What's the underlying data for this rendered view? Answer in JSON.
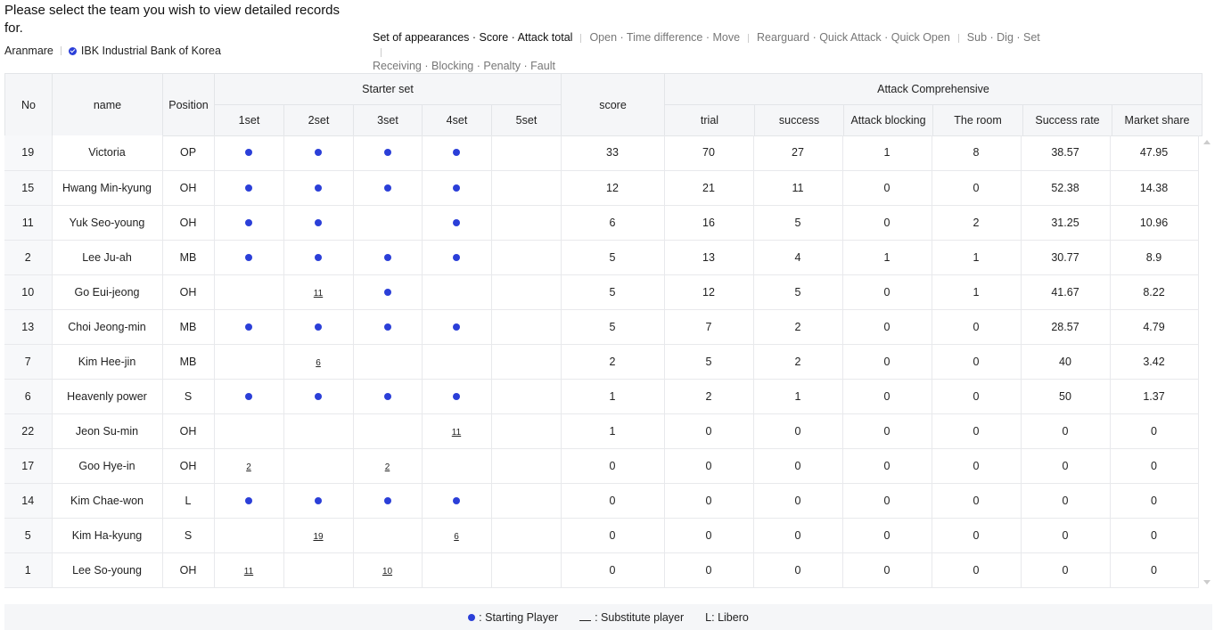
{
  "prompt": "Please select the team you wish to view detailed records for.",
  "teams": [
    {
      "label": "Aranmare",
      "selected": false
    },
    {
      "label": "IBK Industrial Bank of Korea",
      "selected": true
    }
  ],
  "categories": [
    {
      "line": 1,
      "label": "Set of appearances · Score · Attack total",
      "active": true
    },
    {
      "line": 1,
      "label": "Open · Time difference · Move",
      "active": false
    },
    {
      "line": 1,
      "label": "Rearguard · Quick Attack · Quick Open",
      "active": false
    },
    {
      "line": 1,
      "label": "Sub · Dig · Set",
      "active": false
    },
    {
      "line": 2,
      "label": "Receiving · Blocking · Penalty · Fault",
      "active": false
    }
  ],
  "headers": {
    "no": "No",
    "name": "name",
    "position": "Position",
    "starter_set": "Starter set",
    "sets": [
      "1set",
      "2set",
      "3set",
      "4set",
      "5set"
    ],
    "score": "score",
    "attack_group": "Attack Comprehensive",
    "attack_cols": [
      "trial",
      "success",
      "Attack blocking",
      "The room",
      "Success rate",
      "Market share"
    ]
  },
  "rows": [
    {
      "no": "19",
      "name": "Victoria",
      "pos": "OP",
      "sets": [
        "S",
        "S",
        "S",
        "S",
        ""
      ],
      "score": "33",
      "attack": [
        "70",
        "27",
        "1",
        "8",
        "38.57",
        "47.95"
      ]
    },
    {
      "no": "15",
      "name": "Hwang Min-kyung",
      "pos": "OH",
      "sets": [
        "S",
        "S",
        "S",
        "S",
        ""
      ],
      "score": "12",
      "attack": [
        "21",
        "11",
        "0",
        "0",
        "52.38",
        "14.38"
      ]
    },
    {
      "no": "11",
      "name": "Yuk Seo-young",
      "pos": "OH",
      "sets": [
        "S",
        "S",
        "",
        "S",
        ""
      ],
      "score": "6",
      "attack": [
        "16",
        "5",
        "0",
        "2",
        "31.25",
        "10.96"
      ]
    },
    {
      "no": "2",
      "name": "Lee Ju-ah",
      "pos": "MB",
      "sets": [
        "S",
        "S",
        "S",
        "S",
        ""
      ],
      "score": "5",
      "attack": [
        "13",
        "4",
        "1",
        "1",
        "30.77",
        "8.9"
      ]
    },
    {
      "no": "10",
      "name": "Go Eui-jeong",
      "pos": "OH",
      "sets": [
        "",
        "11",
        "S",
        "",
        ""
      ],
      "score": "5",
      "attack": [
        "12",
        "5",
        "0",
        "1",
        "41.67",
        "8.22"
      ]
    },
    {
      "no": "13",
      "name": "Choi Jeong-min",
      "pos": "MB",
      "sets": [
        "S",
        "S",
        "S",
        "S",
        ""
      ],
      "score": "5",
      "attack": [
        "7",
        "2",
        "0",
        "0",
        "28.57",
        "4.79"
      ]
    },
    {
      "no": "7",
      "name": "Kim Hee-jin",
      "pos": "MB",
      "sets": [
        "",
        "6",
        "",
        "",
        ""
      ],
      "score": "2",
      "attack": [
        "5",
        "2",
        "0",
        "0",
        "40",
        "3.42"
      ]
    },
    {
      "no": "6",
      "name": "Heavenly power",
      "pos": "S",
      "sets": [
        "S",
        "S",
        "S",
        "S",
        ""
      ],
      "score": "1",
      "attack": [
        "2",
        "1",
        "0",
        "0",
        "50",
        "1.37"
      ]
    },
    {
      "no": "22",
      "name": "Jeon Su-min",
      "pos": "OH",
      "sets": [
        "",
        "",
        "",
        "11",
        ""
      ],
      "score": "1",
      "attack": [
        "0",
        "0",
        "0",
        "0",
        "0",
        "0"
      ]
    },
    {
      "no": "17",
      "name": "Goo Hye-in",
      "pos": "OH",
      "sets": [
        "2",
        "",
        "2",
        "",
        ""
      ],
      "score": "0",
      "attack": [
        "0",
        "0",
        "0",
        "0",
        "0",
        "0"
      ]
    },
    {
      "no": "14",
      "name": "Kim Chae-won",
      "pos": "L",
      "sets": [
        "S",
        "S",
        "S",
        "S",
        ""
      ],
      "score": "0",
      "attack": [
        "0",
        "0",
        "0",
        "0",
        "0",
        "0"
      ]
    },
    {
      "no": "5",
      "name": "Kim Ha-kyung",
      "pos": "S",
      "sets": [
        "",
        "19",
        "",
        "6",
        ""
      ],
      "score": "0",
      "attack": [
        "0",
        "0",
        "0",
        "0",
        "0",
        "0"
      ]
    },
    {
      "no": "1",
      "name": "Lee So-young",
      "pos": "OH",
      "sets": [
        "11",
        "",
        "10",
        "",
        ""
      ],
      "score": "0",
      "attack": [
        "0",
        "0",
        "0",
        "0",
        "0",
        "0"
      ]
    }
  ],
  "legend": {
    "starting": ": Starting Player",
    "substitute": ": Substitute player",
    "libero": "L: Libero"
  },
  "colors": {
    "accent": "#2b3fd8",
    "header_bg": "#f5f6f8",
    "border": "#e3e5e8"
  }
}
